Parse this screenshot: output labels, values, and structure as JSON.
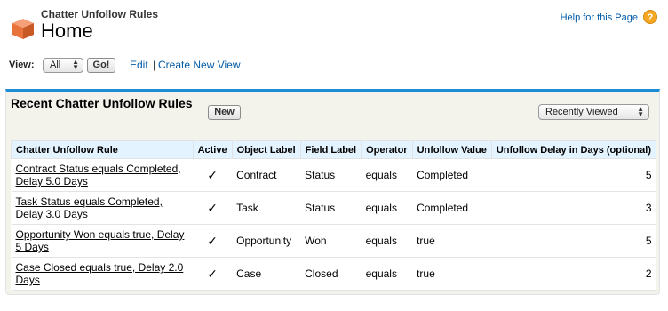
{
  "header": {
    "subtitle": "Chatter Unfollow Rules",
    "title": "Home",
    "help_link": "Help for this Page",
    "help_icon": "?"
  },
  "viewbar": {
    "label": "View:",
    "selected": "All",
    "go_label": "Go!",
    "edit_label": "Edit",
    "separator": "|",
    "create_label": "Create New View"
  },
  "panel": {
    "title": "Recent Chatter Unfollow Rules",
    "new_label": "New",
    "sort_selected": "Recently Viewed",
    "columns": [
      "Chatter Unfollow Rule",
      "Active",
      "Object Label",
      "Field Label",
      "Operator",
      "Unfollow Value",
      "Unfollow Delay in Days (optional)"
    ],
    "rows": [
      {
        "rule": "Contract Status equals Completed, Delay 5.0 Days",
        "active": "✓",
        "object": "Contract",
        "field": "Status",
        "operator": "equals",
        "value": "Completed",
        "delay": "5"
      },
      {
        "rule": "Task Status equals Completed, Delay 3.0 Days",
        "active": "✓",
        "object": "Task",
        "field": "Status",
        "operator": "equals",
        "value": "Completed",
        "delay": "3"
      },
      {
        "rule": "Opportunity Won equals true, Delay 5 Days",
        "active": "✓",
        "object": "Opportunity",
        "field": "Won",
        "operator": "equals",
        "value": "true",
        "delay": "5"
      },
      {
        "rule": "Case Closed equals true, Delay 2.0 Days",
        "active": "✓",
        "object": "Case",
        "field": "Closed",
        "operator": "equals",
        "value": "true",
        "delay": "2"
      }
    ]
  },
  "colors": {
    "link": "#015ba7",
    "panel_border": "#1f8dd6",
    "header_bg": "#e3f3ff",
    "icon": "#e8743b"
  }
}
